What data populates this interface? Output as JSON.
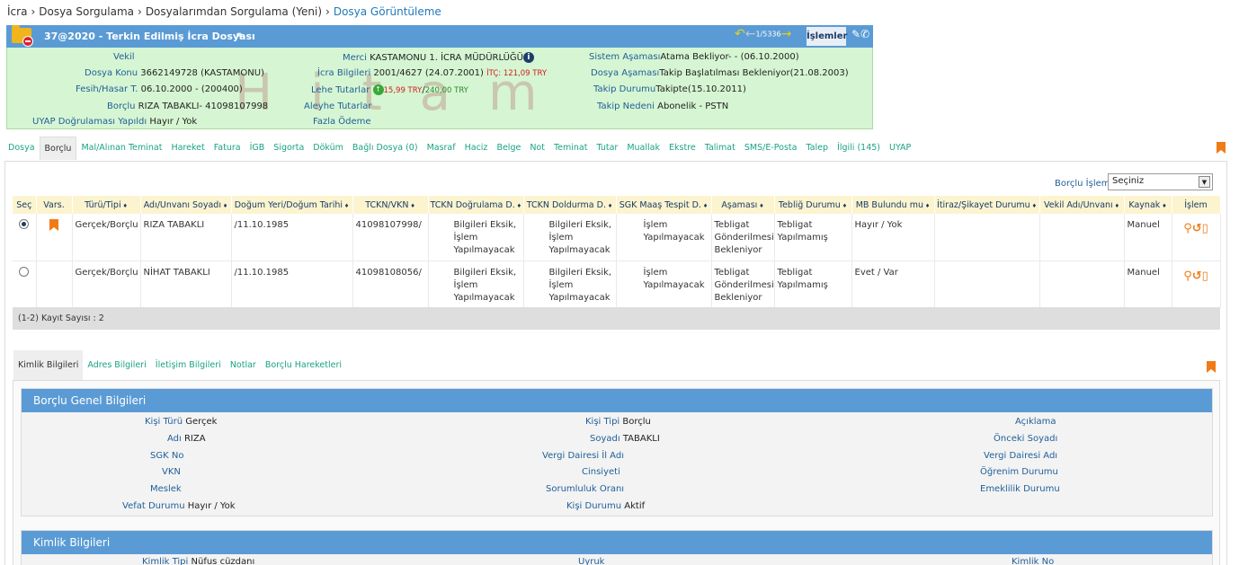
{
  "breadcrumb": [
    "İcra",
    "Dosya Sorgulama",
    "Dosyalarımdan Sorgulama (Yeni)",
    "Dosya Görüntüleme"
  ],
  "header": {
    "title": "37@2020 - Terkin Edilmiş İcra Dosyası",
    "nav_count": "1/5336",
    "islemler_label": "İşlemler",
    "watermark": "Hitam"
  },
  "summary": {
    "vekil_label": "Vekil",
    "dosya_konu_label": "Dosya Konu",
    "dosya_konu": "3662149728 (KASTAMONU)",
    "fesih_label": "Fesih/Hasar T.",
    "fesih": "06.10.2000 - (200400)",
    "borclu_label": "Borçlu",
    "borclu": "RIZA TABAKLI- 41098107998",
    "uyap_label": "UYAP Doğrulaması Yapıldı",
    "uyap": "Hayır / Yok",
    "merci_label": "Merci",
    "merci": "KASTAMONU 1. İCRA MÜDÜRLÜĞÜ",
    "icra_label": "İcra Bilgileri",
    "icra": "2001/4627 (24.07.2001)",
    "itc": "İTÇ: 121,09 TRY",
    "lehe_label": "Lehe Tutarlar",
    "lehe_red": "15,99 TRY",
    "lehe_green": "240,00 TRY",
    "aleyhe_label": "Aleyhe Tutarlar",
    "fazla_label": "Fazla Ödeme",
    "sistem_label": "Sistem Aşaması",
    "sistem": "Atama Bekliyor- - (06.10.2000)",
    "dosya_asamasi_label": "Dosya Aşaması",
    "dosya_asamasi": "Takip Başlatılması Bekleniyor(21.08.2003)",
    "takip_durumu_label": "Takip Durumu",
    "takip_durumu": "Takipte(15.10.2011)",
    "takip_nedeni_label": "Takip Nedeni",
    "takip_nedeni": "Abonelik - PSTN"
  },
  "tabs": [
    "Dosya",
    "Borçlu",
    "Mal/Alınan Teminat",
    "Hareket",
    "Fatura",
    "İGB",
    "Sigorta",
    "Döküm",
    "Bağlı Dosya (0)",
    "Masraf",
    "Haciz",
    "Belge",
    "Not",
    "Teminat",
    "Tutar",
    "Muallak",
    "Ekstre",
    "Talimat",
    "SMS/E-Posta",
    "Talep",
    "İlgili (145)",
    "UYAP"
  ],
  "borclu_islem": {
    "label": "Borçlu İşlem",
    "selected": "Seçiniz"
  },
  "table": {
    "headers": [
      "Seç",
      "Vars.",
      "Türü/Tipi",
      "Adı/Unvanı Soyadı",
      "Doğum Yeri/Doğum Tarihi",
      "TCKN/VKN",
      "TCKN Doğrulama D.",
      "TCKN Doldurma D.",
      "SGK Maaş Tespit D.",
      "Aşaması",
      "Tebliğ Durumu",
      "MB Bulundu mu",
      "İtiraz/Şikayet Durumu",
      "Vekil Adı/Unvanı",
      "Kaynak",
      "İşlem"
    ],
    "rows": [
      {
        "turu": "Gerçek/Borçlu",
        "adi": "RIZA TABAKLI",
        "dogum": "/11.10.1985",
        "tckn": "41098107998/",
        "dogrulama": "Bilgileri Eksik, İşlem Yapılmayacak",
        "doldurma": "Bilgileri Eksik, İşlem Yapılmayacak",
        "sgk": "İşlem Yapılmayacak",
        "asama": "Tebligat Gönderilmesi Bekleniyor",
        "teblig": "Tebligat Yapılmamış",
        "mb": "Hayır / Yok",
        "itiraz": "",
        "vekil": "",
        "kaynak": "Manuel"
      },
      {
        "turu": "Gerçek/Borçlu",
        "adi": "NİHAT TABAKLI",
        "dogum": "/11.10.1985",
        "tckn": "41098108056/",
        "dogrulama": "Bilgileri Eksik, İşlem Yapılmayacak",
        "doldurma": "Bilgileri Eksik, İşlem Yapılmayacak",
        "sgk": "İşlem Yapılmayacak",
        "asama": "Tebligat Gönderilmesi Bekleniyor",
        "teblig": "Tebligat Yapılmamış",
        "mb": "Evet / Var",
        "itiraz": "",
        "vekil": "",
        "kaynak": "Manuel"
      }
    ],
    "footer": "(1-2) Kayıt Sayısı : 2"
  },
  "subtabs": [
    "Kimlik Bilgileri",
    "Adres Bilgileri",
    "İletişim Bilgileri",
    "Notlar",
    "Borçlu Hareketleri"
  ],
  "genel": {
    "title": "Borçlu Genel Bilgileri",
    "kisi_turu_label": "Kişi Türü",
    "kisi_turu": "Gerçek",
    "adi_label": "Adı",
    "adi": "RIZA",
    "sgk_label": "SGK No",
    "vkn_label": "VKN",
    "meslek_label": "Meslek",
    "vefat_label": "Vefat Durumu",
    "vefat": "Hayır / Yok",
    "kisi_tipi_label": "Kişi Tipi",
    "kisi_tipi": "Borçlu",
    "soyadi_label": "Soyadı",
    "soyadi": "TABAKLI",
    "vergi_il_label": "Vergi Dairesi İl Adı",
    "cinsiyet_label": "Cinsiyeti",
    "sorumluluk_label": "Sorumluluk Oranı",
    "kisi_durumu_label": "Kişi Durumu",
    "kisi_durumu": "Aktif",
    "aciklama_label": "Açıklama",
    "onceki_soyadi_label": "Önceki Soyadı",
    "vergi_dairesi_label": "Vergi Dairesi Adı",
    "ogrenim_label": "Öğrenim Durumu",
    "emeklilik_label": "Emeklilik Durumu"
  },
  "kimlik": {
    "title": "Kimlik Bilgileri",
    "kimlik_tipi_label": "Kimlik Tipi",
    "kimlik_tipi": "Nüfus cüzdanı",
    "uyruk_label": "Uyruk",
    "kimlik_no_label": "Kimlik No"
  }
}
